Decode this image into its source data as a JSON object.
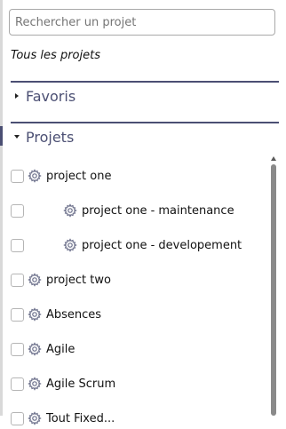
{
  "search": {
    "placeholder": "Rechercher un projet",
    "value": ""
  },
  "all_projects_label": "Tous les projets",
  "sections": {
    "favorites": {
      "label": "Favoris",
      "expanded": false,
      "caret_icon": "caret-right-icon"
    },
    "projects": {
      "label": "Projets",
      "expanded": true,
      "caret_icon": "caret-down-icon"
    }
  },
  "projects": [
    {
      "name": "project one",
      "level": 0,
      "checked": false,
      "icon": "gear-icon"
    },
    {
      "name": "project one - maintenance",
      "level": 1,
      "checked": false,
      "icon": "gear-icon"
    },
    {
      "name": "project one - developement",
      "level": 1,
      "checked": false,
      "icon": "gear-icon"
    },
    {
      "name": "project two",
      "level": 0,
      "checked": false,
      "icon": "gear-icon"
    },
    {
      "name": "Absences",
      "level": 0,
      "checked": false,
      "icon": "gear-icon"
    },
    {
      "name": "Agile",
      "level": 0,
      "checked": false,
      "icon": "gear-icon"
    },
    {
      "name": "Agile Scrum",
      "level": 0,
      "checked": false,
      "icon": "gear-icon"
    },
    {
      "name": "Tout Fixed...",
      "level": 0,
      "checked": false,
      "icon": "gear-icon"
    }
  ],
  "colors": {
    "accent": "#4b4f73",
    "text": "#111111",
    "icon": "#6b6f8a"
  }
}
